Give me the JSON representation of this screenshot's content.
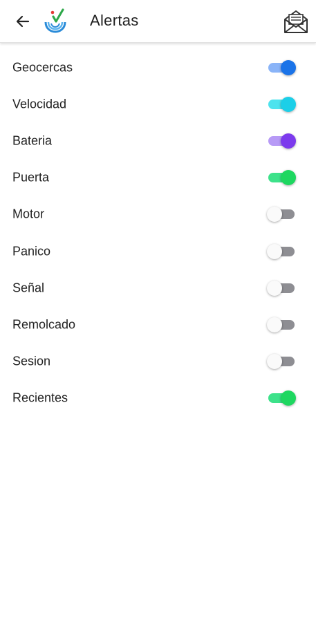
{
  "header": {
    "title": "Alertas",
    "back_icon": "arrow-left-icon",
    "logo_icon": "app-logo-icon",
    "mail_icon": "open-envelope-icon"
  },
  "alerts": [
    {
      "label": "Geocercas",
      "on": true,
      "color": "#1a73e8",
      "track": "#8ab4f8"
    },
    {
      "label": "Velocidad",
      "on": true,
      "color": "#1ccfe8",
      "track": "#4de3ee"
    },
    {
      "label": "Bateria",
      "on": true,
      "color": "#7c3aed",
      "track": "#b79af6"
    },
    {
      "label": "Puerta",
      "on": true,
      "color": "#1ed760",
      "track": "#3de28a"
    },
    {
      "label": "Motor",
      "on": false,
      "color": "#fafafa",
      "track": "#8e8e93"
    },
    {
      "label": "Panico",
      "on": false,
      "color": "#fafafa",
      "track": "#8e8e93"
    },
    {
      "label": "Señal",
      "on": false,
      "color": "#fafafa",
      "track": "#8e8e93"
    },
    {
      "label": "Remolcado",
      "on": false,
      "color": "#fafafa",
      "track": "#8e8e93"
    },
    {
      "label": "Sesion",
      "on": false,
      "color": "#fafafa",
      "track": "#8e8e93"
    },
    {
      "label": "Recientes",
      "on": true,
      "color": "#1ed760",
      "track": "#3de28a"
    }
  ]
}
